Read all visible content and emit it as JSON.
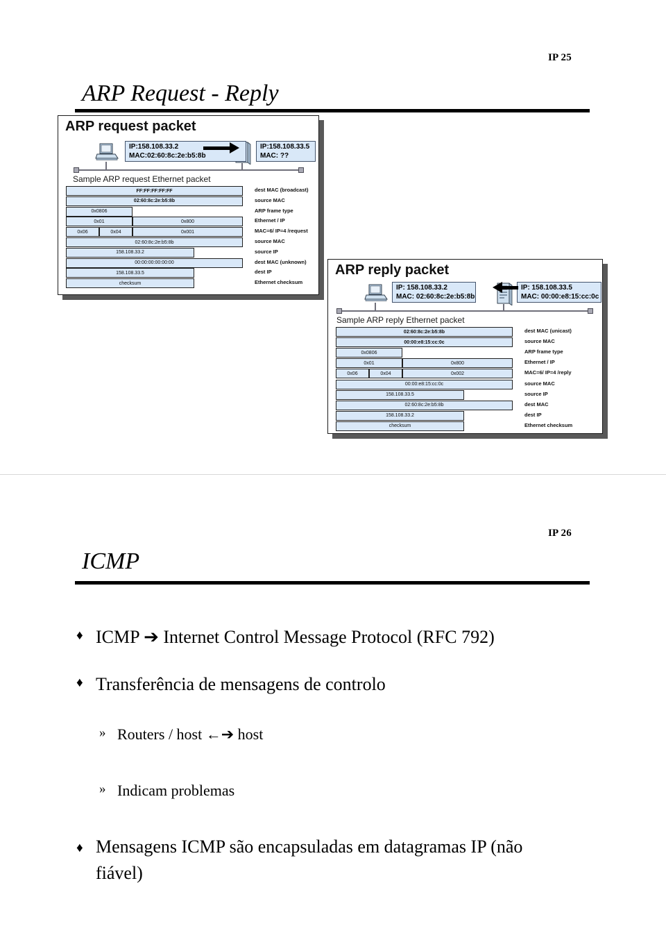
{
  "slide_arp": {
    "number": "IP 25",
    "title": "ARP Request - Reply",
    "request": {
      "heading": "ARP request packet",
      "host_box": {
        "ip": "IP:158.108.33.2",
        "mac": "MAC:02:60:8c:2e:b5:8b"
      },
      "target_box": {
        "ip": "IP:158.108.33.5",
        "mac": "MAC: ??"
      },
      "sample_label": "Sample ARP request Ethernet packet",
      "rows": [
        {
          "cells": [
            {
              "text": "FF:FF:FF:FF:FF",
              "bold": true
            }
          ],
          "ann": "dest MAC (broadcast)"
        },
        {
          "cells": [
            {
              "text": "02:60:8c:2e:b5:8b",
              "bold": true
            }
          ],
          "ann": "source MAC"
        },
        {
          "cells": [
            {
              "text": "0x0806",
              "bold": false
            }
          ],
          "ann": "ARP frame type"
        },
        {
          "cells": [
            {
              "text": "0x01",
              "bold": false
            },
            {
              "text": "0x800",
              "bold": false
            }
          ],
          "ann": "Ethernet / IP"
        },
        {
          "cells": [
            {
              "text": "0x06",
              "bold": false
            },
            {
              "text": "0x04",
              "bold": false
            },
            {
              "text": "0x001",
              "bold": false
            }
          ],
          "ann": "MAC=6/ IP=4 /request"
        },
        {
          "cells": [
            {
              "text": "02:60:8c:2e:b5:8b",
              "bold": false
            }
          ],
          "ann": "source MAC"
        },
        {
          "cells": [
            {
              "text": "158.108.33.2",
              "bold": false
            }
          ],
          "ann": "source IP"
        },
        {
          "cells": [
            {
              "text": "00:00:00:00:00:00",
              "bold": false
            }
          ],
          "ann": "dest MAC (unknown)"
        },
        {
          "cells": [
            {
              "text": "158.108.33.5",
              "bold": false
            }
          ],
          "ann": "dest IP"
        },
        {
          "cells": [
            {
              "text": "checksum",
              "bold": false
            }
          ],
          "ann": "Ethernet checksum"
        }
      ]
    },
    "reply": {
      "heading": "ARP reply packet",
      "host_box": {
        "ip": "IP: 158.108.33.2",
        "mac": "MAC: 02:60:8c:2e:b5:8b"
      },
      "target_box": {
        "ip": "IP: 158.108.33.5",
        "mac": "MAC: 00:00:e8:15:cc:0c"
      },
      "sample_label": "Sample ARP reply Ethernet packet",
      "rows": [
        {
          "cells": [
            {
              "text": "02:60:8c:2e:b5:8b",
              "bold": true
            }
          ],
          "ann": "dest MAC (unicast)"
        },
        {
          "cells": [
            {
              "text": "00:00:e8:15:cc:0c",
              "bold": true
            }
          ],
          "ann": "source MAC"
        },
        {
          "cells": [
            {
              "text": "0x0806",
              "bold": false
            }
          ],
          "ann": "ARP frame type"
        },
        {
          "cells": [
            {
              "text": "0x01",
              "bold": false
            },
            {
              "text": "0x800",
              "bold": false
            }
          ],
          "ann": "Ethernet / IP"
        },
        {
          "cells": [
            {
              "text": "0x06",
              "bold": false
            },
            {
              "text": "0x04",
              "bold": false
            },
            {
              "text": "0x002",
              "bold": false
            }
          ],
          "ann": "MAC=6/ IP=4 /reply"
        },
        {
          "cells": [
            {
              "text": "00:00:e8:15:cc:0c",
              "bold": false
            }
          ],
          "ann": "source MAC"
        },
        {
          "cells": [
            {
              "text": "158.108.33.5",
              "bold": false
            }
          ],
          "ann": "source IP"
        },
        {
          "cells": [
            {
              "text": "02:60:8c:2e:b5:8b",
              "bold": false
            }
          ],
          "ann": "dest MAC"
        },
        {
          "cells": [
            {
              "text": "158.108.33.2",
              "bold": false
            }
          ],
          "ann": "dest IP"
        },
        {
          "cells": [
            {
              "text": "checksum",
              "bold": false
            }
          ],
          "ann": "Ethernet checksum"
        }
      ]
    }
  },
  "slide_icmp": {
    "number": "IP 26",
    "title": "ICMP",
    "bullets": [
      {
        "marker": "♦",
        "text": "ICMP ➔ Internet Control Message Protocol (RFC 792)"
      },
      {
        "marker": "♦",
        "text": "Transferência  de mensagens de controlo"
      },
      {
        "marker": "»",
        "text": "Routers / host ←➔ host"
      },
      {
        "marker": "»",
        "text": "Indicam problemas"
      },
      {
        "marker": "♦",
        "text": "Mensagens ICMP são encapsuladas em datagramas IP (não fiável)"
      }
    ]
  },
  "colors": {
    "packet_fill": "#d9e8f8",
    "packet_border": "#1f1f1f",
    "panel_shadow": "#595959",
    "rule": "#000000"
  }
}
